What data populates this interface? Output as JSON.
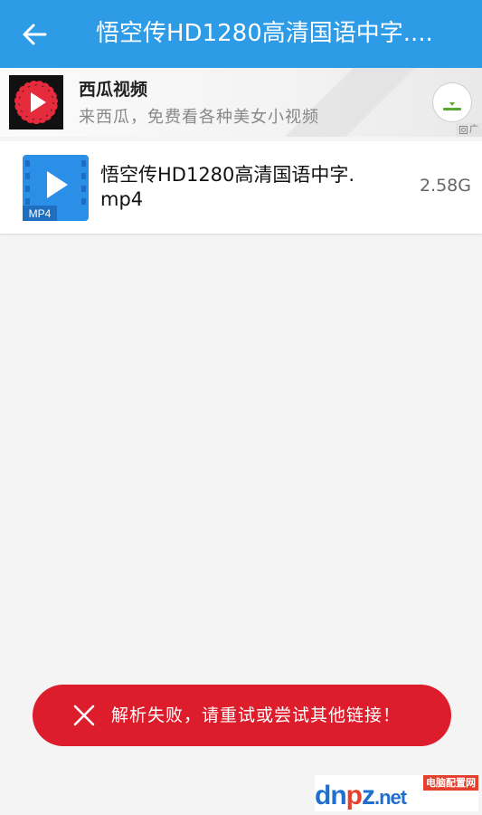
{
  "appbar": {
    "title": "悟空传HD1280高清国语中字....",
    "back_icon": "arrow-left-icon",
    "background_color": "#2d9be6"
  },
  "ad": {
    "app_name": "西瓜视频",
    "description": "来西瓜，免费看各种美女小视频",
    "logo_icon": "watermelon-play-icon",
    "download_icon": "download-icon",
    "badge_label": "广"
  },
  "file": {
    "name": "悟空传HD1280高清国语中字.mp4",
    "size": "2.58G",
    "type_label": "MP4",
    "icon": "video-file-icon",
    "icon_color": "#2b8fe8"
  },
  "toast": {
    "message": "解析失败，请重试或尝试其他链接！",
    "icon": "close-icon",
    "background_color": "#dd1c2c"
  },
  "watermark": {
    "text_d": "d",
    "text_n": "n",
    "text_p": "p",
    "text_z": "z",
    "text_net": ".net",
    "cn_label": "电脑配置网"
  }
}
